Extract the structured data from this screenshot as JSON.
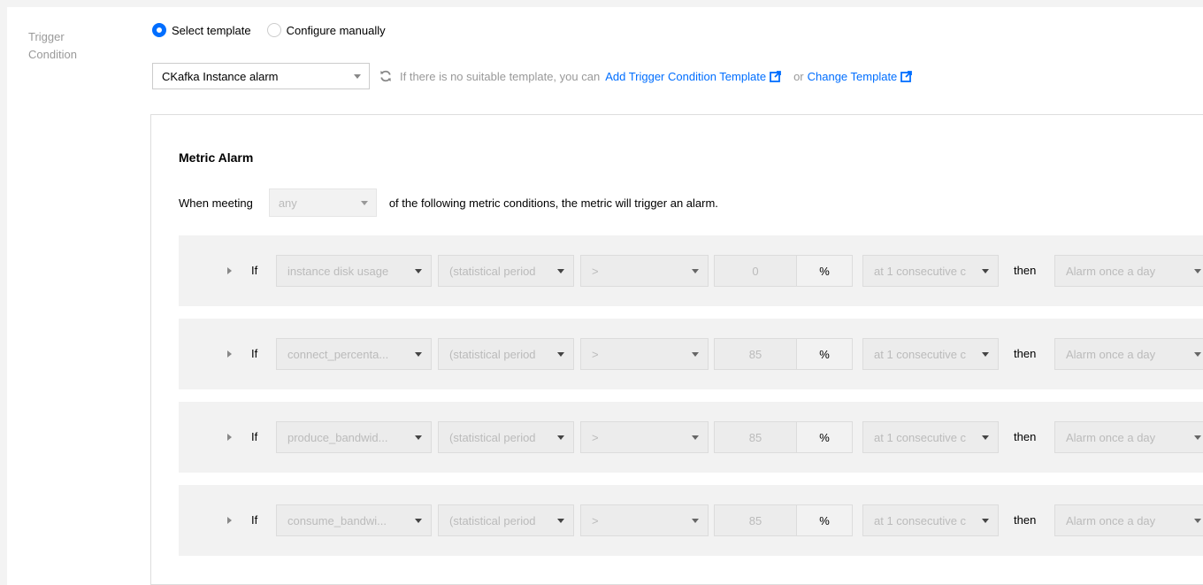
{
  "field_label": "Trigger Condition",
  "mode": {
    "options": [
      {
        "label": "Select template",
        "checked": true
      },
      {
        "label": "Configure manually",
        "checked": false
      }
    ]
  },
  "template": {
    "selected": "CKafka Instance alarm",
    "hint": "If there is no suitable template, you can",
    "add_link": "Add Trigger Condition Template",
    "or_text": "or",
    "change_link": "Change Template"
  },
  "alarm": {
    "title": "Metric Alarm",
    "meet_prefix": "When meeting",
    "meet_value": "any",
    "meet_suffix": "of the following metric conditions, the metric will trigger an alarm.",
    "if_label": "If",
    "then_label": "then",
    "conditions": [
      {
        "metric": "instance disk usage",
        "period": "(statistical period",
        "op": ">",
        "value": "0",
        "unit": "%",
        "consecutive": "at 1 consecutive c",
        "frequency": "Alarm once a day"
      },
      {
        "metric": "connect_percenta...",
        "period": "(statistical period",
        "op": ">",
        "value": "85",
        "unit": "%",
        "consecutive": "at 1 consecutive c",
        "frequency": "Alarm once a day"
      },
      {
        "metric": "produce_bandwid...",
        "period": "(statistical period",
        "op": ">",
        "value": "85",
        "unit": "%",
        "consecutive": "at 1 consecutive c",
        "frequency": "Alarm once a day"
      },
      {
        "metric": "consume_bandwi...",
        "period": "(statistical period",
        "op": ">",
        "value": "85",
        "unit": "%",
        "consecutive": "at 1 consecutive c",
        "frequency": "Alarm once a day"
      }
    ]
  },
  "colors": {
    "accent": "#006eff",
    "muted": "#999999",
    "panel": "#f2f2f2"
  }
}
